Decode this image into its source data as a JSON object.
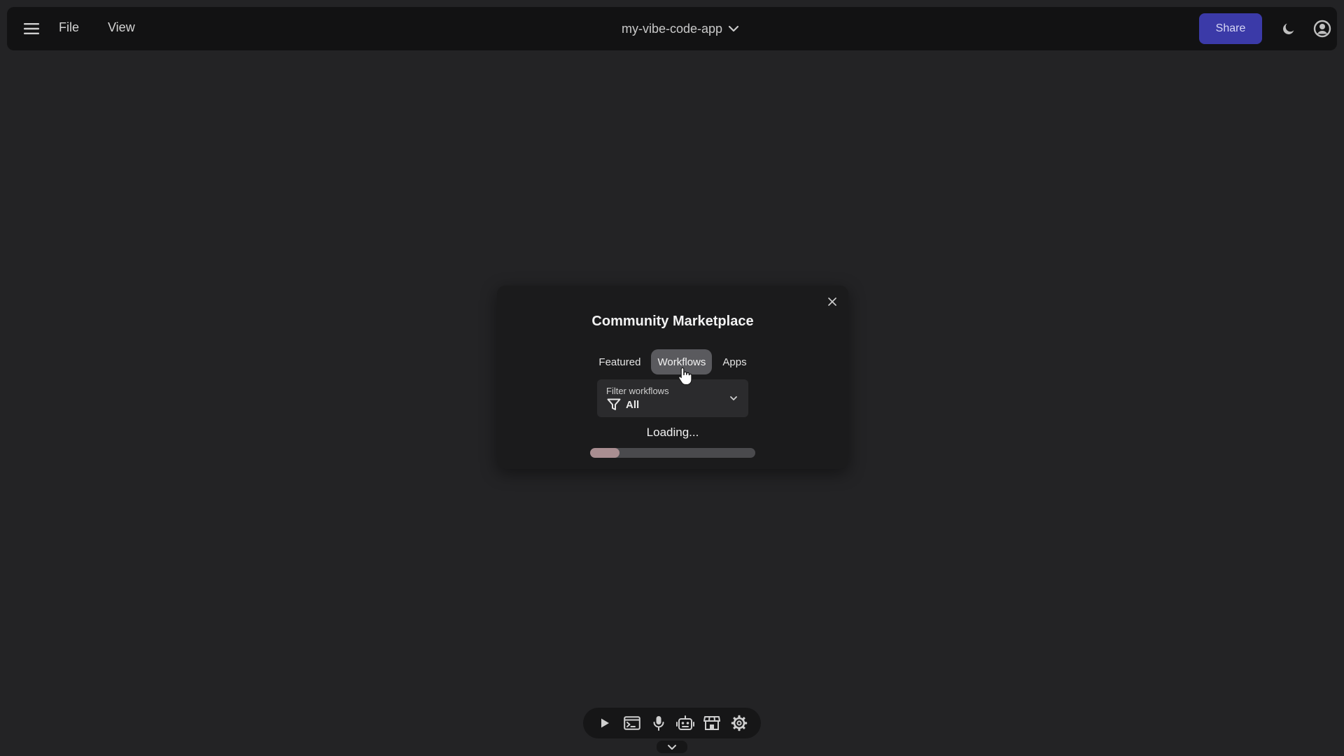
{
  "header": {
    "file_label": "File",
    "view_label": "View",
    "project_name": "my-vibe-code-app",
    "share_label": "Share"
  },
  "modal": {
    "title": "Community Marketplace",
    "tabs": [
      {
        "label": "Featured",
        "active": false
      },
      {
        "label": "Workflows",
        "active": true
      },
      {
        "label": "Apps",
        "active": false
      }
    ],
    "filter": {
      "label": "Filter workflows",
      "value": "All"
    },
    "loading_text": "Loading...",
    "progress_fraction": 0.18
  },
  "toolbar": {
    "icons": [
      "play-icon",
      "terminal-icon",
      "microphone-icon",
      "robot-icon",
      "store-icon",
      "gear-icon"
    ]
  },
  "colors": {
    "accent": "#3b3aa8",
    "background": "#232325",
    "topbar": "#121213",
    "progress_fill": "#a98e91"
  }
}
